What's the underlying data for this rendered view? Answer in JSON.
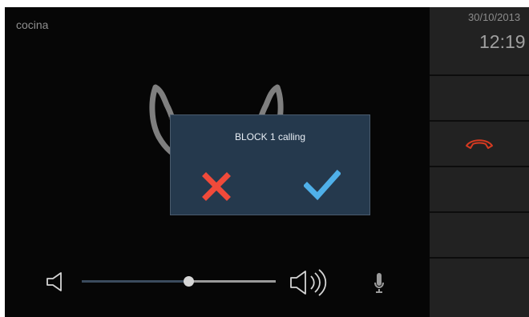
{
  "screen": {
    "location_label": "cocina"
  },
  "status": {
    "date": "30/10/2013",
    "time": "12:19"
  },
  "sidebar": {
    "buttons": [
      {
        "name": "datetime-panel",
        "icon": ""
      },
      {
        "name": "empty-button-1",
        "icon": ""
      },
      {
        "name": "hangup-button",
        "icon": "hangup-icon"
      },
      {
        "name": "empty-button-2",
        "icon": ""
      },
      {
        "name": "empty-button-3",
        "icon": ""
      },
      {
        "name": "empty-button-4",
        "icon": ""
      }
    ]
  },
  "dialog": {
    "title": "BLOCK 1 calling",
    "reject_icon": "close-icon",
    "accept_icon": "check-icon"
  },
  "volume": {
    "level_percent": 55,
    "low_icon": "speaker-low-icon",
    "high_icon": "speaker-high-icon",
    "mic_icon": "microphone-icon"
  },
  "colors": {
    "reject": "#f04a3a",
    "accept": "#4fb0e9",
    "hangup": "#d63a21",
    "dialog_bg": "#25394d"
  }
}
